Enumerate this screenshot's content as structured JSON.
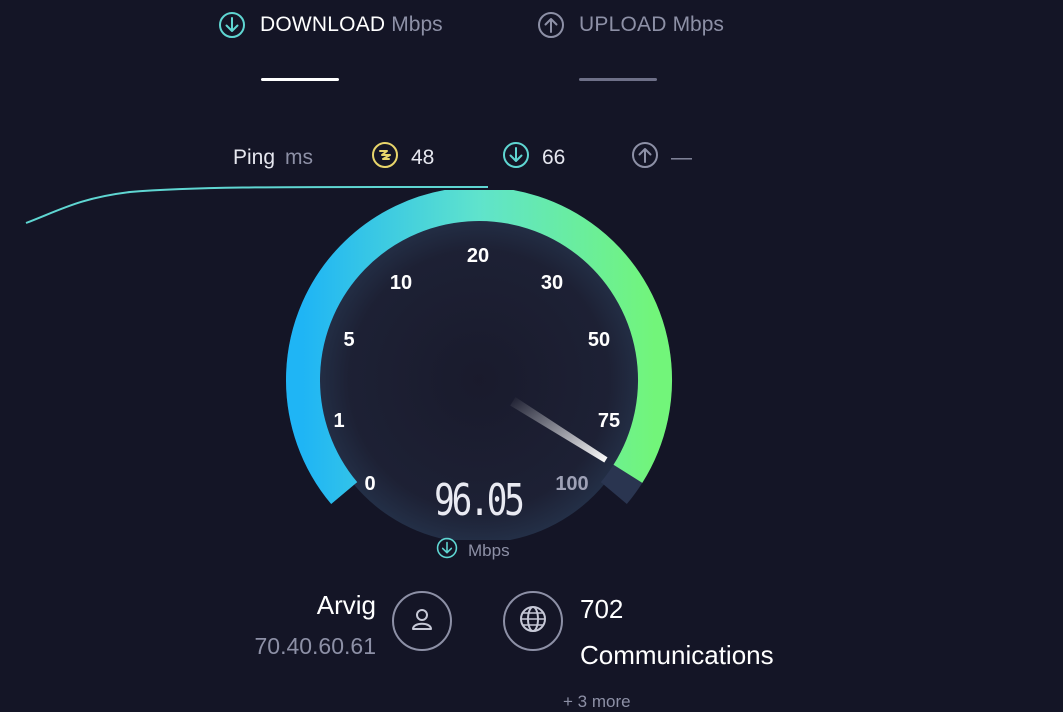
{
  "tabs": {
    "download": {
      "label": "DOWNLOAD",
      "unit": "Mbps",
      "icon": "download-arrow-icon"
    },
    "upload": {
      "label": "UPLOAD",
      "unit": "Mbps",
      "icon": "upload-arrow-icon"
    }
  },
  "ping": {
    "label": "Ping",
    "unit": "ms",
    "idle": {
      "icon": "ping-idle-icon",
      "value": "48",
      "color": "#e8d56b"
    },
    "download": {
      "icon": "download-arrow-icon",
      "value": "66",
      "color": "#5fd6d2"
    },
    "upload": {
      "icon": "upload-arrow-icon",
      "value": "—",
      "color": "#8d90a6"
    }
  },
  "gauge": {
    "labels": [
      "0",
      "1",
      "5",
      "10",
      "20",
      "30",
      "50",
      "75",
      "100"
    ],
    "value": "96.05",
    "unit": "Mbps",
    "fraction": 0.97,
    "colors": {
      "start": "#1fb5f5",
      "mid": "#5fe3cc",
      "end": "#72f57a"
    }
  },
  "isp": {
    "name": "Arvig",
    "ip": "70.40.60.61",
    "icon": "user-icon"
  },
  "server": {
    "name_line1": "702",
    "name_line2": "Communications",
    "more": "+ 3 more",
    "icon": "globe-icon"
  },
  "colors": {
    "background": "#141526",
    "accent": "#5fd6d2",
    "muted": "#8d90a6"
  }
}
